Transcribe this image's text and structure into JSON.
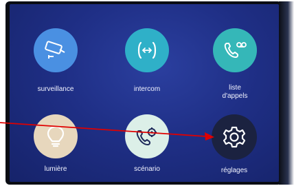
{
  "tiles": [
    {
      "label": "surveillance",
      "icon": "camera-icon",
      "color": "#4a90e2"
    },
    {
      "label": "intercom",
      "icon": "intercom-call-icon",
      "color": "#2fb0c8"
    },
    {
      "label": "liste\nd'appels",
      "icon": "call-log-icon",
      "color": "#35b7b8"
    },
    {
      "label": "lumière",
      "icon": "lightbulb-icon",
      "color": "#e7d7bd"
    },
    {
      "label": "scénario",
      "icon": "scenario-phone-gear-icon",
      "color": "#dcefe8"
    },
    {
      "label": "réglages",
      "icon": "gear-icon",
      "color": "#1b2240"
    }
  ],
  "annotation": {
    "arrow_color": "#e00000",
    "target": "réglages"
  }
}
